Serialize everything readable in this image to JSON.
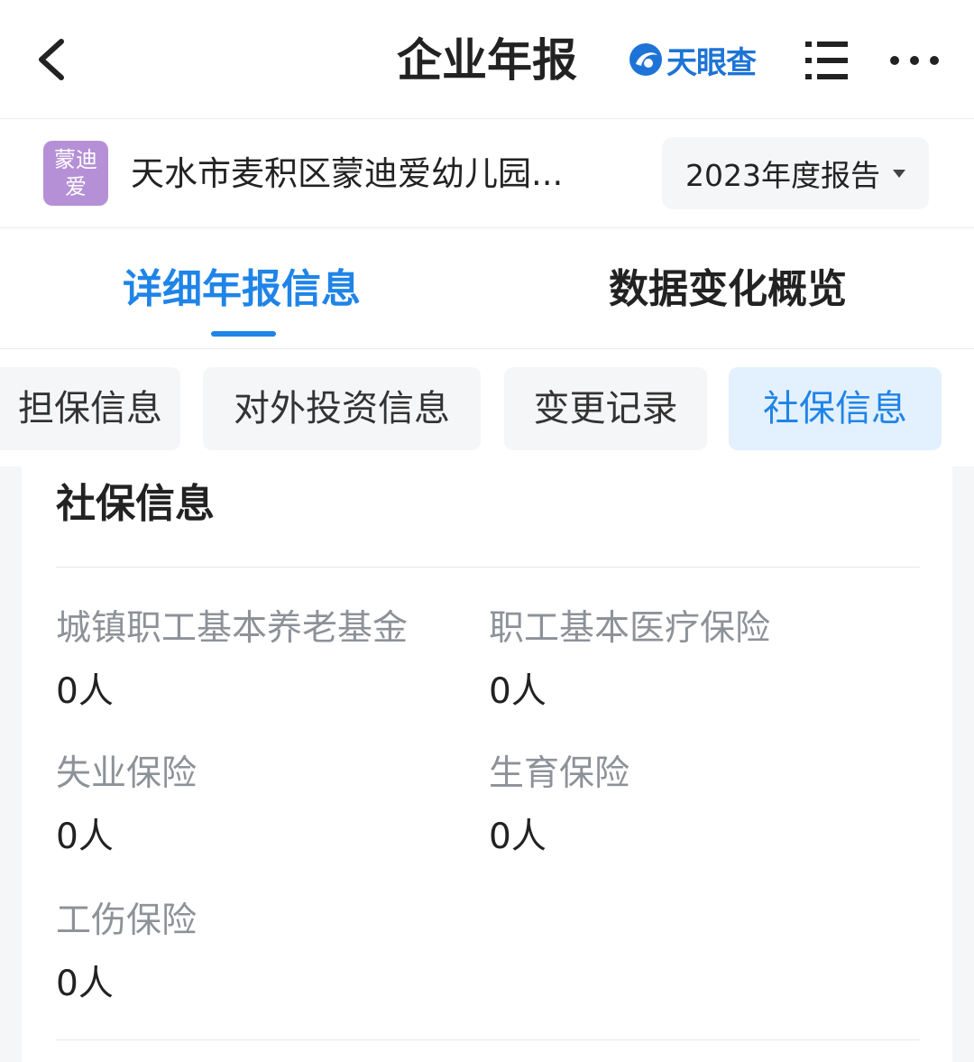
{
  "nav": {
    "title": "企业年报",
    "brand_name": "天眼查",
    "icons": [
      "back-icon",
      "tianyancha-logo-icon",
      "menu-list-icon",
      "more-icon"
    ]
  },
  "company": {
    "logo_line1": "蒙迪",
    "logo_line2": "爱",
    "name": "天水市麦积区蒙迪爱幼儿园...",
    "year_label": "2023年度报告",
    "logo_color": "#b590d6"
  },
  "main_tabs": [
    {
      "label": "详细年报信息",
      "active": true
    },
    {
      "label": "数据变化概览",
      "active": false
    }
  ],
  "sub_tabs": [
    {
      "label": "担保信息",
      "active": false
    },
    {
      "label": "对外投资信息",
      "active": false
    },
    {
      "label": "变更记录",
      "active": false
    },
    {
      "label": "社保信息",
      "active": true
    }
  ],
  "social_insurance": {
    "title": "社保信息",
    "fields": [
      {
        "label": "城镇职工基本养老基金",
        "value": "0人"
      },
      {
        "label": "职工基本医疗保险",
        "value": "0人"
      },
      {
        "label": "失业保险",
        "value": "0人"
      },
      {
        "label": "生育保险",
        "value": "0人"
      },
      {
        "label": "工伤保险",
        "value": "0人"
      }
    ]
  },
  "colors": {
    "accent": "#1f84e8",
    "brand": "#1d74d6",
    "label_gray": "#8d9299",
    "chip_bg": "#f5f6f8",
    "chip_active_bg": "#e3f0fd"
  }
}
